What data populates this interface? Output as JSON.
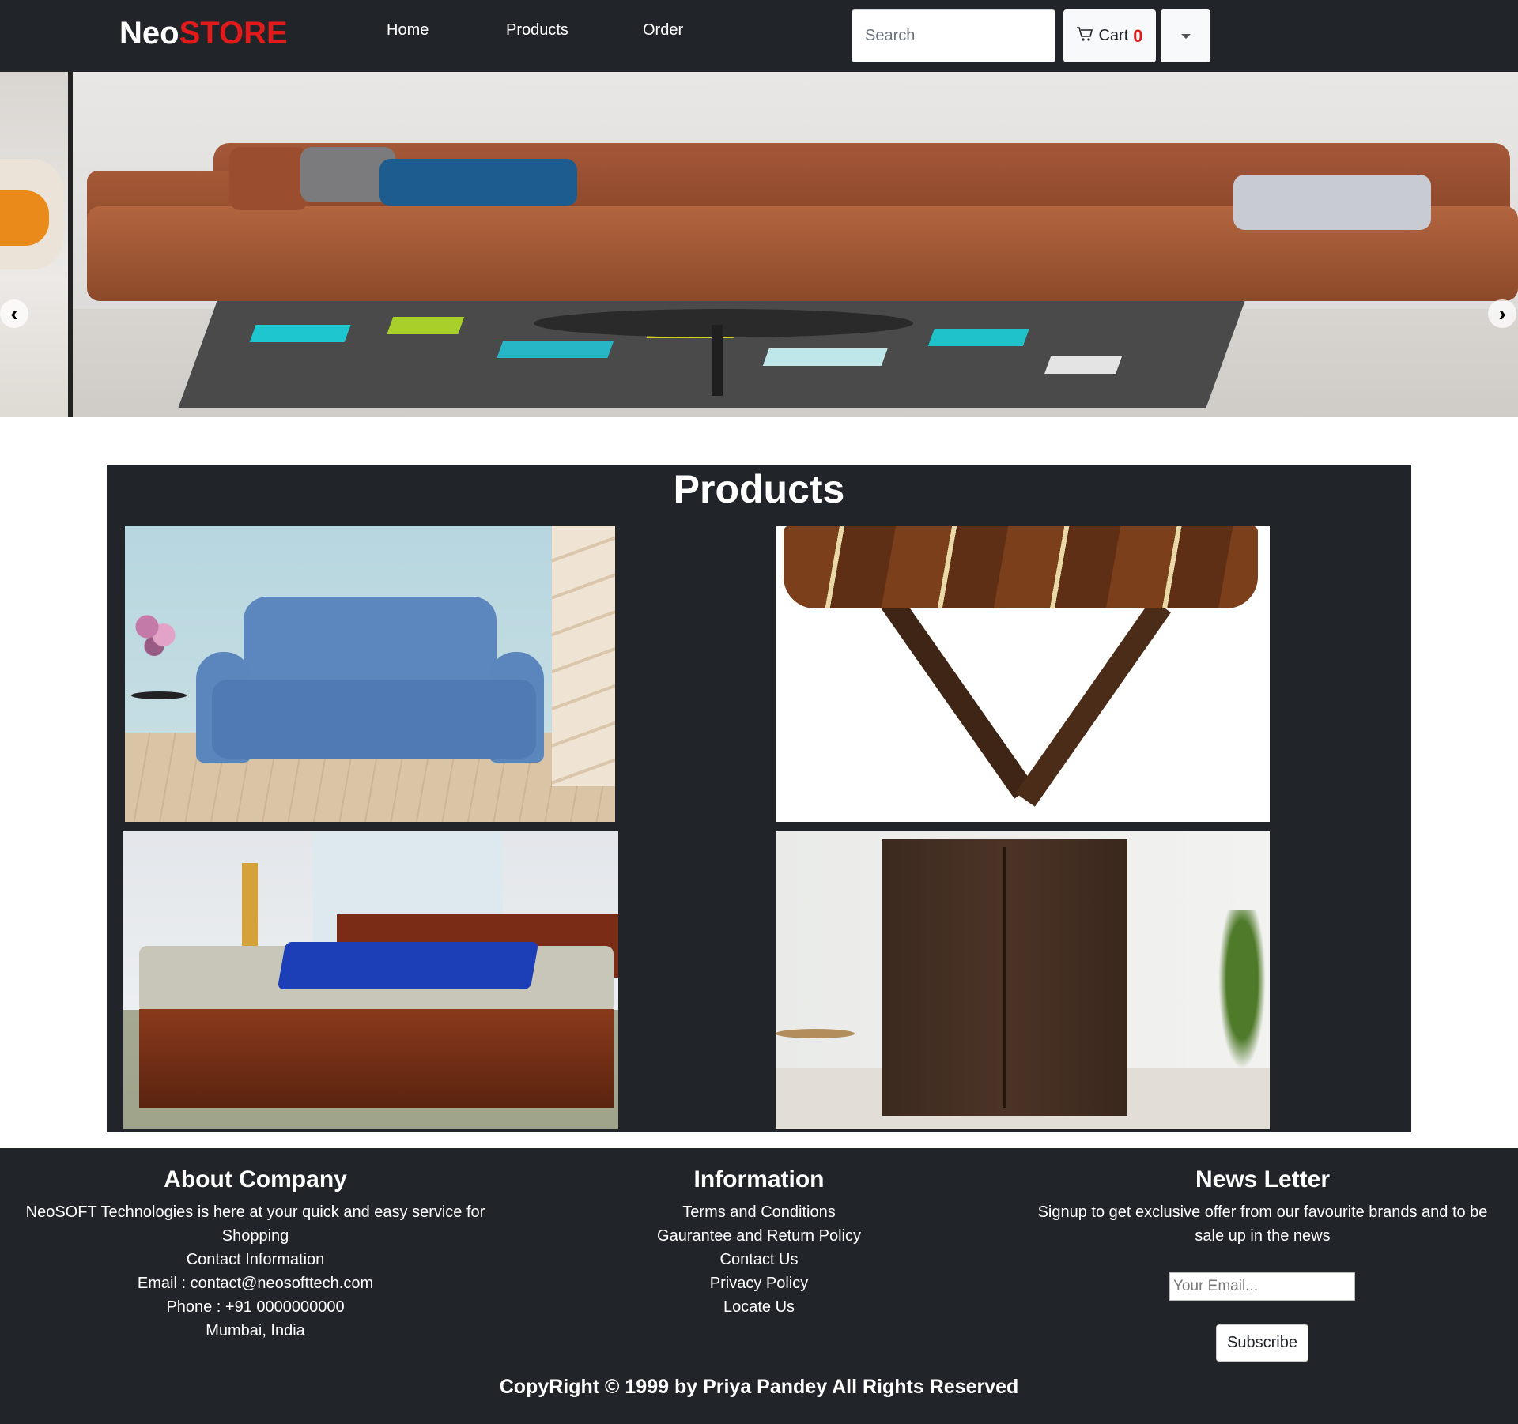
{
  "navbar": {
    "brand_part1": "Neo",
    "brand_part2": "STORE",
    "links": [
      {
        "label": "Home"
      },
      {
        "label": "Products"
      },
      {
        "label": "Order"
      }
    ],
    "search_placeholder": "Search",
    "cart_label": "Cart",
    "cart_count": "0",
    "cart_icon": "cart-icon",
    "dropdown_icon": "caret-down-icon"
  },
  "hero": {
    "prev_arrow": "‹",
    "next_arrow": "›"
  },
  "products": {
    "title": "Products"
  },
  "footer": {
    "about": {
      "title": "About Company",
      "lines": [
        "NeoSOFT Technologies is here at your quick and easy service for",
        "Shopping",
        "Contact Information",
        "Email : contact@neosofttech.com",
        "Phone : +91 0000000000",
        "Mumbai, India"
      ]
    },
    "information": {
      "title": "Information",
      "links": [
        "Terms and Conditions",
        "Gaurantee and Return Policy",
        "Contact Us",
        "Privacy Policy",
        "Locate Us"
      ]
    },
    "newsletter": {
      "title": "News Letter",
      "lines": [
        "Signup to get exclusive offer from our favourite brands and to be",
        "sale up in the news"
      ],
      "email_placeholder": "Your Email...",
      "subscribe_label": "Subscribe"
    },
    "copyright": "CopyRight © 1999 by Priya Pandey All Rights Reserved"
  },
  "colors": {
    "dark": "#212529",
    "accent": "#e11b1b"
  }
}
